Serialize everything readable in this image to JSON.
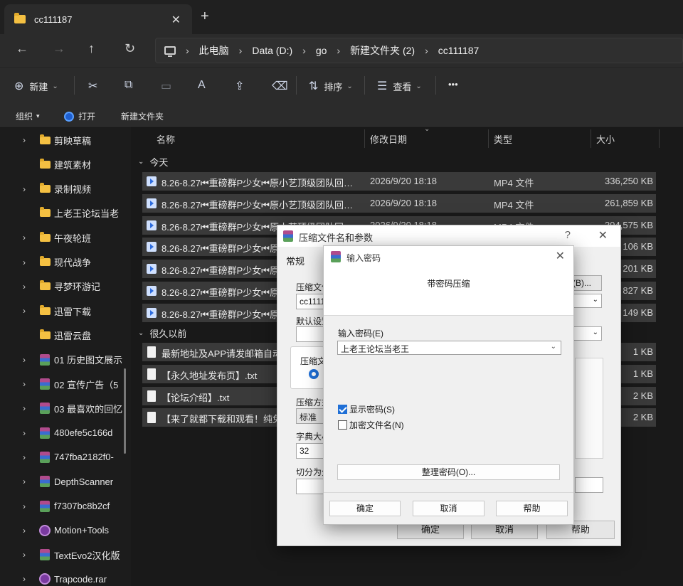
{
  "tabbar": {
    "tab_title": "cc111187",
    "close": "✕",
    "new_tab": "+"
  },
  "nav": {
    "back": "←",
    "forward": "→",
    "up": "↑",
    "refresh": "↻",
    "breadcrumbs": [
      "此电脑",
      "Data (D:)",
      "go",
      "新建文件夹 (2)",
      "cc111187"
    ],
    "sep": "›"
  },
  "toolbar": {
    "new_label": "新建",
    "sort_label": "排序",
    "view_label": "查看",
    "more": "•••",
    "cut": "✂",
    "copy": "⧉",
    "paste": "📋",
    "rename": "A",
    "share": "⇪",
    "delete": "🗑"
  },
  "subbar": {
    "organize": "组织",
    "open": "打开",
    "new_folder": "新建文件夹"
  },
  "sidebar": {
    "items": [
      {
        "label": "剪映草稿",
        "icon": "folder",
        "arrow": true
      },
      {
        "label": "建筑素材",
        "icon": "folder",
        "arrow": false
      },
      {
        "label": "录制视频",
        "icon": "folder",
        "arrow": true
      },
      {
        "label": "上老王论坛当老",
        "icon": "folder",
        "arrow": false
      },
      {
        "label": "午夜轮班",
        "icon": "folder",
        "arrow": true
      },
      {
        "label": "现代战争",
        "icon": "folder",
        "arrow": true
      },
      {
        "label": "寻梦环游记",
        "icon": "folder",
        "arrow": true
      },
      {
        "label": "迅雷下载",
        "icon": "folder",
        "arrow": true
      },
      {
        "label": "迅雷云盘",
        "icon": "folder",
        "arrow": false
      },
      {
        "label": "01 历史图文展示",
        "icon": "rar",
        "arrow": true
      },
      {
        "label": "02 宣传广告（5",
        "icon": "rar",
        "arrow": true
      },
      {
        "label": "03 最喜欢的回忆",
        "icon": "rar",
        "arrow": true
      },
      {
        "label": "480efe5c166d",
        "icon": "rar",
        "arrow": true
      },
      {
        "label": "747fba2182f0-",
        "icon": "rar",
        "arrow": true
      },
      {
        "label": "DepthScanner",
        "icon": "rar",
        "arrow": true
      },
      {
        "label": "f7307bc8b2cf",
        "icon": "rar",
        "arrow": true
      },
      {
        "label": "Motion+Tools",
        "icon": "app",
        "arrow": true
      },
      {
        "label": "TextEvo2汉化版",
        "icon": "rar",
        "arrow": true
      },
      {
        "label": "Trapcode.rar",
        "icon": "app",
        "arrow": true
      }
    ]
  },
  "list": {
    "columns": {
      "name": "名称",
      "date": "修改日期",
      "type": "类型",
      "size": "大小"
    },
    "group_today": "今天",
    "group_old": "很久以前",
    "today_rows": [
      {
        "name": "8.26-8.27⏮重磅群P少女⏮原小艺顶级团队回…",
        "date": "2026/9/20 18:18",
        "type": "MP4 文件",
        "size": "336,250 KB"
      },
      {
        "name": "8.26-8.27⏮重磅群P少女⏮原小艺顶级团队回…",
        "date": "2026/9/20 18:18",
        "type": "MP4 文件",
        "size": "261,859 KB"
      },
      {
        "name": "8.26-8.27⏮重磅群P少女⏮原小艺顶级团队回…",
        "date": "2026/9/20 18:18",
        "type": "MP4 文件",
        "size": "394,575 KB"
      },
      {
        "name": "8.26-8.27⏮重磅群P少女⏮原小艺顶级团队回…",
        "date": "",
        "type": "",
        "size": "106 KB"
      },
      {
        "name": "8.26-8.27⏮重磅群P少女⏮原小艺顶级团队回…",
        "date": "",
        "type": "",
        "size": "201 KB"
      },
      {
        "name": "8.26-8.27⏮重磅群P少女⏮原小艺顶级团队回…",
        "date": "",
        "type": "",
        "size": "827 KB"
      },
      {
        "name": "8.26-8.27⏮重磅群P少女⏮原小艺顶级团队回…",
        "date": "",
        "type": "",
        "size": "149 KB"
      }
    ],
    "old_rows": [
      {
        "name": "最新地址及APP请发邮箱自动获取",
        "size": "1 KB"
      },
      {
        "name": "【永久地址发布页】.txt",
        "size": "1 KB"
      },
      {
        "name": "【论坛介绍】.txt",
        "size": "2 KB"
      },
      {
        "name": "【来了就都下载和观看！纯免费",
        "size": "2 KB"
      }
    ]
  },
  "archive_dialog": {
    "title": "压缩文件名和参数",
    "help": "?",
    "close": "✕",
    "tab_general": "常规",
    "archive_name_label": "压缩文件",
    "archive_name_value": "cc1111",
    "browse_label": "(B)...",
    "default_label": "默认设置",
    "format_label": "压缩文",
    "method_label": "压缩方式",
    "method_value": "标准",
    "dict_label": "字典大小",
    "dict_value": "32",
    "split_label": "切分为分",
    "ok": "确定",
    "cancel": "取消",
    "help_btn": "帮助"
  },
  "password_dialog": {
    "title": "输入密码",
    "close": "✕",
    "heading": "带密码压缩",
    "input_label": "输入密码(E)",
    "input_value": "上老王论坛当老王",
    "show_password": "显示密码(S)",
    "show_password_checked": true,
    "encrypt_names": "加密文件名(N)",
    "encrypt_names_checked": false,
    "organize_btn": "整理密码(O)...",
    "ok": "确定",
    "cancel": "取消",
    "help_btn": "帮助"
  }
}
